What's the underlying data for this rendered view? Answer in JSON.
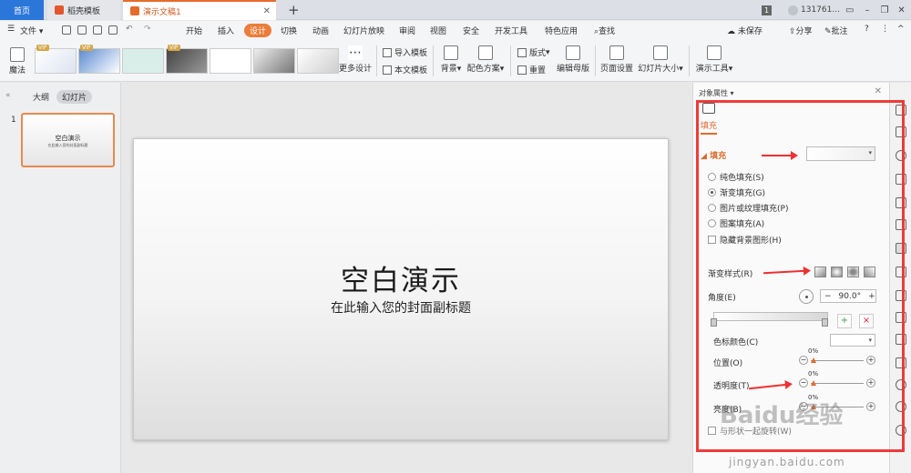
{
  "titlebar": {
    "tab_home": "首页",
    "tab_daoke": "稻壳模板",
    "tab_doc": "演示文稿1",
    "page_badge": "1",
    "user": "131761...",
    "brand_color": "#2b76d9",
    "accent_color": "#e46b2c"
  },
  "menu": {
    "file": "文件",
    "items": [
      "开始",
      "插入",
      "设计",
      "切换",
      "动画",
      "幻灯片放映",
      "审阅",
      "视图",
      "安全",
      "开发工具",
      "特色应用",
      "查找"
    ],
    "active": "设计",
    "unsaved": "未保存",
    "share": "分享",
    "comment": "批注"
  },
  "ribbon": {
    "magic": "魔法",
    "more_design": "更多设计",
    "import_template": "导入模板",
    "text_template": "本文模板",
    "background": "背景",
    "color_scheme": "配色方案",
    "layout": "版式",
    "reset": "重置",
    "edit_master": "编辑母版",
    "page_setup": "页面设置",
    "slide_size": "幻灯片大小",
    "presentation_tools": "演示工具",
    "vip": "VIP"
  },
  "left_panel": {
    "tab_outline": "大纲",
    "tab_slides": "幻灯片",
    "slide_number": "1",
    "thumb_title": "空白演示",
    "thumb_sub": "在此输入您的封面副标题"
  },
  "slide": {
    "title": "空白演示",
    "subtitle": "在此输入您的封面副标题"
  },
  "props": {
    "title": "对象属性",
    "tab_fill": "填充",
    "section_fill": "填充",
    "options": [
      "纯色填充(S)",
      "渐变填充(G)",
      "图片或纹理填充(P)",
      "图案填充(A)"
    ],
    "selected_option": "渐变填充(G)",
    "hide_bg": "隐藏背景图形(H)",
    "grad_style_label": "渐变样式(R)",
    "angle_label": "角度(E)",
    "angle_value": "90.0°",
    "stop_color_label": "色标颜色(C)",
    "position_label": "位置(O)",
    "position_value": "0%",
    "transparency_label": "透明度(T)",
    "transparency_value": "0%",
    "brightness_label": "亮度(B)",
    "brightness_value": "0%",
    "rotate_with_shape": "与形状一起旋转(W)"
  },
  "watermark": {
    "text": "Baidu经验",
    "url": "jingyan.baidu.com"
  }
}
